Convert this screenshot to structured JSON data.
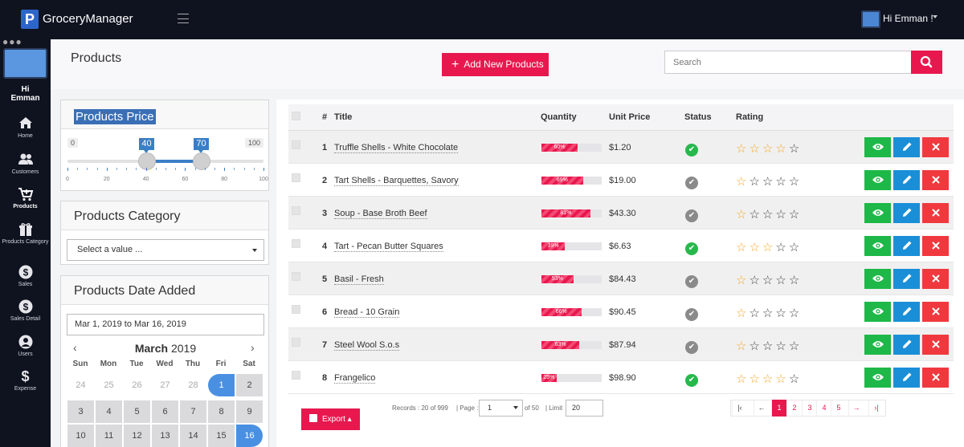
{
  "app": {
    "brand": "GroceryManager",
    "logo_letter": "P",
    "greeting": "Hi Emman !"
  },
  "sidebar": {
    "greeting_line1": "Hi",
    "greeting_line2": "Emman",
    "items": [
      {
        "label": "Home",
        "icon": "home-icon",
        "glyph": "⌂"
      },
      {
        "label": "Customers",
        "icon": "users-icon",
        "glyph": "👥"
      },
      {
        "label": "Products",
        "icon": "cart-icon",
        "glyph": "🛒"
      },
      {
        "label": "Products Category",
        "icon": "gift-icon",
        "glyph": "🎁"
      },
      {
        "label": "Sales",
        "icon": "dollar-circle-icon",
        "glyph": "$"
      },
      {
        "label": "Sales Detail",
        "icon": "dollar-circle-icon",
        "glyph": "$"
      },
      {
        "label": "Users",
        "icon": "user-icon",
        "glyph": "👤"
      },
      {
        "label": "Expense",
        "icon": "dollar-icon",
        "glyph": "$"
      }
    ]
  },
  "header": {
    "title": "Products",
    "add_label": "Add New Products",
    "search_placeholder": "Search"
  },
  "filters": {
    "price": {
      "title": "Products Price",
      "min": "0",
      "max": "100",
      "low": "40",
      "high": "70",
      "ticks": [
        "0",
        "20",
        "40",
        "60",
        "80",
        "100"
      ]
    },
    "category": {
      "title": "Products Category",
      "placeholder": "Select a value ..."
    },
    "date": {
      "title": "Products Date Added",
      "range_text": "Mar 1, 2019 to Mar 16, 2019",
      "month": "March",
      "year": "2019",
      "dows": [
        "Sun",
        "Mon",
        "Tue",
        "Wed",
        "Thu",
        "Fri",
        "Sat"
      ],
      "week1": [
        "24",
        "25",
        "26",
        "27",
        "28",
        "1",
        "2"
      ],
      "week2": [
        "3",
        "4",
        "5",
        "6",
        "7",
        "8",
        "9"
      ],
      "week3": [
        "10",
        "11",
        "12",
        "13",
        "14",
        "15",
        "16"
      ]
    }
  },
  "table": {
    "headers": {
      "num": "#",
      "title": "Title",
      "quantity": "Quantity",
      "unit_price": "Unit Price",
      "status": "Status",
      "rating": "Rating"
    },
    "rows": [
      {
        "num": "1",
        "title": "Truffle Shells - White Chocolate",
        "qty_label": "60%",
        "qty": 0.6,
        "price": "$1.20",
        "status": "active",
        "rating": 4
      },
      {
        "num": "2",
        "title": "Tart Shells - Barquettes, Savory",
        "qty_label": "69%",
        "qty": 0.69,
        "price": "$19.00",
        "status": "inactive",
        "rating": 1
      },
      {
        "num": "3",
        "title": "Soup - Base Broth Beef",
        "qty_label": "81%",
        "qty": 0.81,
        "price": "$43.30",
        "status": "inactive",
        "rating": 1
      },
      {
        "num": "4",
        "title": "Tart - Pecan Butter Squares",
        "qty_label": "39%",
        "qty": 0.39,
        "price": "$6.63",
        "status": "active",
        "rating": 3
      },
      {
        "num": "5",
        "title": "Basil - Fresh",
        "qty_label": "53%",
        "qty": 0.53,
        "price": "$84.43",
        "status": "inactive",
        "rating": 1
      },
      {
        "num": "6",
        "title": "Bread - 10 Grain",
        "qty_label": "66%",
        "qty": 0.66,
        "price": "$90.45",
        "status": "inactive",
        "rating": 1
      },
      {
        "num": "7",
        "title": "Steel Wool S.o.s",
        "qty_label": "63%",
        "qty": 0.63,
        "price": "$87.94",
        "status": "inactive",
        "rating": 1
      },
      {
        "num": "8",
        "title": "Frangelico",
        "qty_label": "25%",
        "qty": 0.25,
        "price": "$98.90",
        "status": "active",
        "rating": 4
      }
    ]
  },
  "footer": {
    "export_label": "Export",
    "records_text": "Records : 20 of 999",
    "page_label": "| Page :",
    "page_value": "1",
    "of_text": "of 50",
    "limit_label": "| Limit",
    "limit_value": "20",
    "pages": [
      "1",
      "2",
      "3",
      "4",
      "5"
    ],
    "first": "|‹",
    "prev": "←",
    "next": "→",
    "last": "›|"
  },
  "colors": {
    "accent": "#e8184e",
    "sidebar": "#0f1320",
    "view": "#1db848",
    "edit": "#1a8fd8",
    "delete": "#f0393e",
    "star": "#f5a623"
  }
}
